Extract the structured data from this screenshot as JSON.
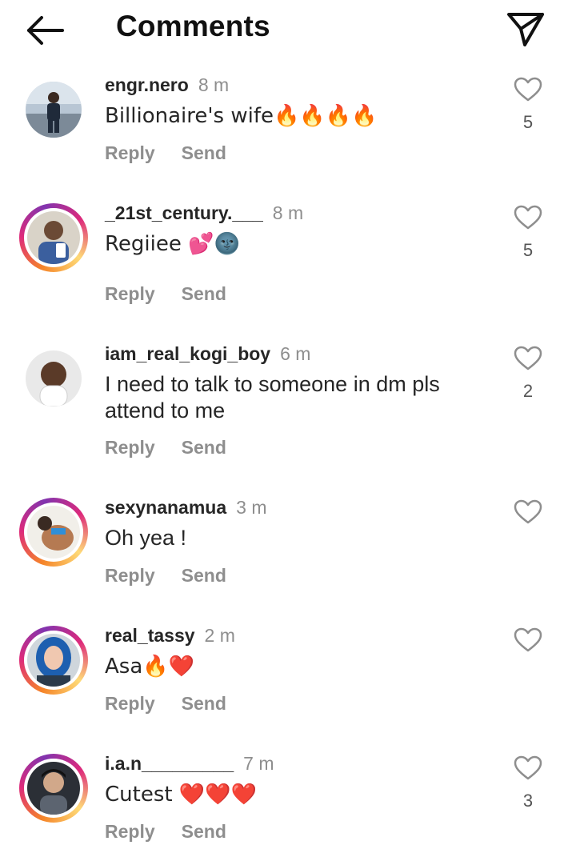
{
  "header": {
    "title": "Comments"
  },
  "comments": [
    {
      "username": "engr.nero",
      "time": "8 m",
      "text": "Billionaire's wife🔥🔥🔥🔥",
      "reply": "Reply",
      "send": "Send",
      "likes": "5"
    },
    {
      "username": "_21st_century.___",
      "time": "8 m",
      "text": "Regiiee 💕🌚",
      "reply": "Reply",
      "send": "Send",
      "likes": "5"
    },
    {
      "username": "iam_real_kogi_boy",
      "time": "6 m",
      "text": "I need to talk to someone in dm pls attend to me",
      "reply": "Reply",
      "send": "Send",
      "likes": "2"
    },
    {
      "username": "sexynanamua",
      "time": "3 m",
      "text": "Oh yea !",
      "reply": "Reply",
      "send": "Send",
      "likes": ""
    },
    {
      "username": "real_tassy",
      "time": "2 m",
      "text": "Asa🔥❤️",
      "reply": "Reply",
      "send": "Send",
      "likes": ""
    },
    {
      "username": "i.a.n_________",
      "time": "7 m",
      "text": "Cutest ❤️❤️❤️",
      "reply": "Reply",
      "send": "Send",
      "likes": "3"
    }
  ],
  "icons": {
    "back": "arrow-left-icon",
    "share": "paper-plane-icon",
    "like": "heart-outline-icon"
  }
}
